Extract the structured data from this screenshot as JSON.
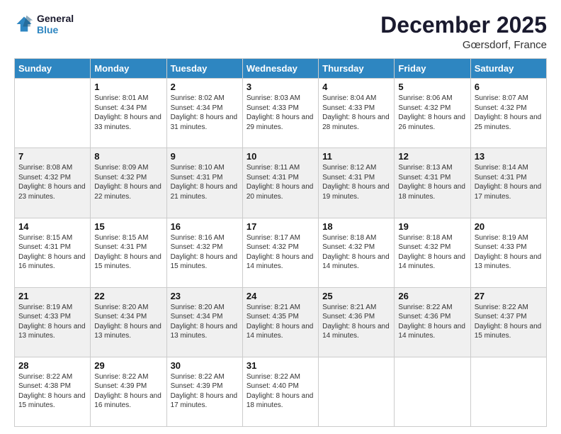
{
  "header": {
    "logo_line1": "General",
    "logo_line2": "Blue",
    "month": "December 2025",
    "location": "Gœrsdorf, France"
  },
  "weekdays": [
    "Sunday",
    "Monday",
    "Tuesday",
    "Wednesday",
    "Thursday",
    "Friday",
    "Saturday"
  ],
  "rows": [
    [
      {
        "day": "",
        "sunrise": "",
        "sunset": "",
        "daylight": ""
      },
      {
        "day": "1",
        "sunrise": "Sunrise: 8:01 AM",
        "sunset": "Sunset: 4:34 PM",
        "daylight": "Daylight: 8 hours and 33 minutes."
      },
      {
        "day": "2",
        "sunrise": "Sunrise: 8:02 AM",
        "sunset": "Sunset: 4:34 PM",
        "daylight": "Daylight: 8 hours and 31 minutes."
      },
      {
        "day": "3",
        "sunrise": "Sunrise: 8:03 AM",
        "sunset": "Sunset: 4:33 PM",
        "daylight": "Daylight: 8 hours and 29 minutes."
      },
      {
        "day": "4",
        "sunrise": "Sunrise: 8:04 AM",
        "sunset": "Sunset: 4:33 PM",
        "daylight": "Daylight: 8 hours and 28 minutes."
      },
      {
        "day": "5",
        "sunrise": "Sunrise: 8:06 AM",
        "sunset": "Sunset: 4:32 PM",
        "daylight": "Daylight: 8 hours and 26 minutes."
      },
      {
        "day": "6",
        "sunrise": "Sunrise: 8:07 AM",
        "sunset": "Sunset: 4:32 PM",
        "daylight": "Daylight: 8 hours and 25 minutes."
      }
    ],
    [
      {
        "day": "7",
        "sunrise": "Sunrise: 8:08 AM",
        "sunset": "Sunset: 4:32 PM",
        "daylight": "Daylight: 8 hours and 23 minutes."
      },
      {
        "day": "8",
        "sunrise": "Sunrise: 8:09 AM",
        "sunset": "Sunset: 4:32 PM",
        "daylight": "Daylight: 8 hours and 22 minutes."
      },
      {
        "day": "9",
        "sunrise": "Sunrise: 8:10 AM",
        "sunset": "Sunset: 4:31 PM",
        "daylight": "Daylight: 8 hours and 21 minutes."
      },
      {
        "day": "10",
        "sunrise": "Sunrise: 8:11 AM",
        "sunset": "Sunset: 4:31 PM",
        "daylight": "Daylight: 8 hours and 20 minutes."
      },
      {
        "day": "11",
        "sunrise": "Sunrise: 8:12 AM",
        "sunset": "Sunset: 4:31 PM",
        "daylight": "Daylight: 8 hours and 19 minutes."
      },
      {
        "day": "12",
        "sunrise": "Sunrise: 8:13 AM",
        "sunset": "Sunset: 4:31 PM",
        "daylight": "Daylight: 8 hours and 18 minutes."
      },
      {
        "day": "13",
        "sunrise": "Sunrise: 8:14 AM",
        "sunset": "Sunset: 4:31 PM",
        "daylight": "Daylight: 8 hours and 17 minutes."
      }
    ],
    [
      {
        "day": "14",
        "sunrise": "Sunrise: 8:15 AM",
        "sunset": "Sunset: 4:31 PM",
        "daylight": "Daylight: 8 hours and 16 minutes."
      },
      {
        "day": "15",
        "sunrise": "Sunrise: 8:15 AM",
        "sunset": "Sunset: 4:31 PM",
        "daylight": "Daylight: 8 hours and 15 minutes."
      },
      {
        "day": "16",
        "sunrise": "Sunrise: 8:16 AM",
        "sunset": "Sunset: 4:32 PM",
        "daylight": "Daylight: 8 hours and 15 minutes."
      },
      {
        "day": "17",
        "sunrise": "Sunrise: 8:17 AM",
        "sunset": "Sunset: 4:32 PM",
        "daylight": "Daylight: 8 hours and 14 minutes."
      },
      {
        "day": "18",
        "sunrise": "Sunrise: 8:18 AM",
        "sunset": "Sunset: 4:32 PM",
        "daylight": "Daylight: 8 hours and 14 minutes."
      },
      {
        "day": "19",
        "sunrise": "Sunrise: 8:18 AM",
        "sunset": "Sunset: 4:32 PM",
        "daylight": "Daylight: 8 hours and 14 minutes."
      },
      {
        "day": "20",
        "sunrise": "Sunrise: 8:19 AM",
        "sunset": "Sunset: 4:33 PM",
        "daylight": "Daylight: 8 hours and 13 minutes."
      }
    ],
    [
      {
        "day": "21",
        "sunrise": "Sunrise: 8:19 AM",
        "sunset": "Sunset: 4:33 PM",
        "daylight": "Daylight: 8 hours and 13 minutes."
      },
      {
        "day": "22",
        "sunrise": "Sunrise: 8:20 AM",
        "sunset": "Sunset: 4:34 PM",
        "daylight": "Daylight: 8 hours and 13 minutes."
      },
      {
        "day": "23",
        "sunrise": "Sunrise: 8:20 AM",
        "sunset": "Sunset: 4:34 PM",
        "daylight": "Daylight: 8 hours and 13 minutes."
      },
      {
        "day": "24",
        "sunrise": "Sunrise: 8:21 AM",
        "sunset": "Sunset: 4:35 PM",
        "daylight": "Daylight: 8 hours and 14 minutes."
      },
      {
        "day": "25",
        "sunrise": "Sunrise: 8:21 AM",
        "sunset": "Sunset: 4:36 PM",
        "daylight": "Daylight: 8 hours and 14 minutes."
      },
      {
        "day": "26",
        "sunrise": "Sunrise: 8:22 AM",
        "sunset": "Sunset: 4:36 PM",
        "daylight": "Daylight: 8 hours and 14 minutes."
      },
      {
        "day": "27",
        "sunrise": "Sunrise: 8:22 AM",
        "sunset": "Sunset: 4:37 PM",
        "daylight": "Daylight: 8 hours and 15 minutes."
      }
    ],
    [
      {
        "day": "28",
        "sunrise": "Sunrise: 8:22 AM",
        "sunset": "Sunset: 4:38 PM",
        "daylight": "Daylight: 8 hours and 15 minutes."
      },
      {
        "day": "29",
        "sunrise": "Sunrise: 8:22 AM",
        "sunset": "Sunset: 4:39 PM",
        "daylight": "Daylight: 8 hours and 16 minutes."
      },
      {
        "day": "30",
        "sunrise": "Sunrise: 8:22 AM",
        "sunset": "Sunset: 4:39 PM",
        "daylight": "Daylight: 8 hours and 17 minutes."
      },
      {
        "day": "31",
        "sunrise": "Sunrise: 8:22 AM",
        "sunset": "Sunset: 4:40 PM",
        "daylight": "Daylight: 8 hours and 18 minutes."
      },
      {
        "day": "",
        "sunrise": "",
        "sunset": "",
        "daylight": ""
      },
      {
        "day": "",
        "sunrise": "",
        "sunset": "",
        "daylight": ""
      },
      {
        "day": "",
        "sunrise": "",
        "sunset": "",
        "daylight": ""
      }
    ]
  ]
}
